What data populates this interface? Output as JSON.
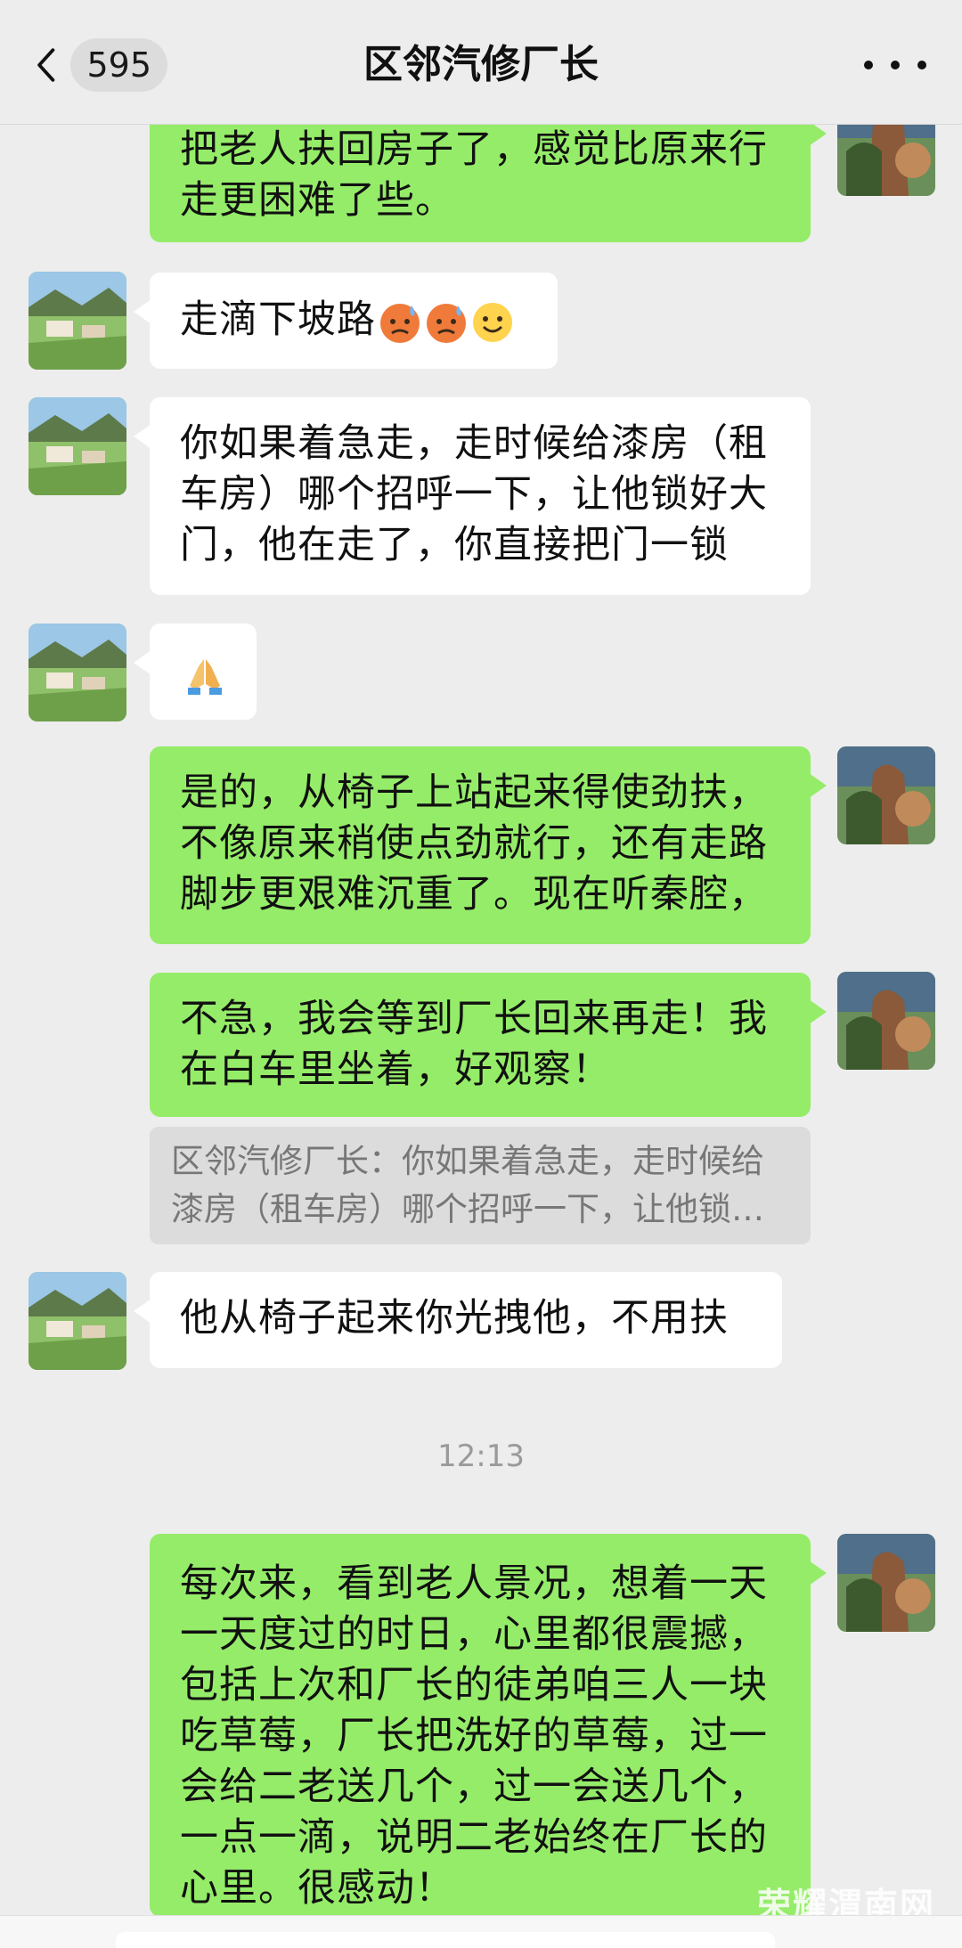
{
  "header": {
    "back_label": "返回",
    "unread_count": "595",
    "title": "区邻汽修厂长"
  },
  "messages": [
    {
      "id": "m1",
      "dir": "out",
      "text": "把老人扶回房子了，感觉比原来行走更困难了些。"
    },
    {
      "id": "m2",
      "dir": "in",
      "text": "走滴下坡路",
      "emojis": [
        "cold-sweat-face-icon",
        "cold-sweat-face-icon",
        "smile-face-icon"
      ]
    },
    {
      "id": "m3",
      "dir": "in",
      "text": "你如果着急走，走时候给漆房（租车房）哪个招呼一下，让他锁好大门，他在走了，你直接把门一锁"
    },
    {
      "id": "m4",
      "dir": "in",
      "text": "",
      "emojis": [
        "folded-hands-icon"
      ]
    },
    {
      "id": "m5",
      "dir": "out",
      "text": "是的，从椅子上站起来得使劲扶，不像原来稍使点劲就行，还有走路脚步更艰难沉重了。现在听秦腔，"
    },
    {
      "id": "m6",
      "dir": "out",
      "text": "不急，我会等到厂长回来再走！我在白车里坐着，好观察！"
    },
    {
      "id": "m7",
      "dir": "in",
      "text": "他从椅子起来你光拽他，不用扶"
    },
    {
      "id": "m8",
      "dir": "out",
      "text": "每次来，看到老人景况，想着一天一天度过的时日，心里都很震撼，包括上次和厂长的徒弟咱三人一块吃草莓，厂长把洗好的草莓，过一会给二老送几个，过一会送几个，一点一滴，说明二老始终在厂长的心里。很感动！"
    }
  ],
  "quote": {
    "line1": "区邻汽修厂长：你如果着急走，走时候给",
    "line2": "漆房（租车房）哪个招呼一下，让他锁好…"
  },
  "time_separator": "12:13",
  "watermark": "荣耀渭南网",
  "colors": {
    "outgoing_bubble": "#95ec69",
    "incoming_bubble": "#ffffff",
    "background": "#ededed"
  }
}
